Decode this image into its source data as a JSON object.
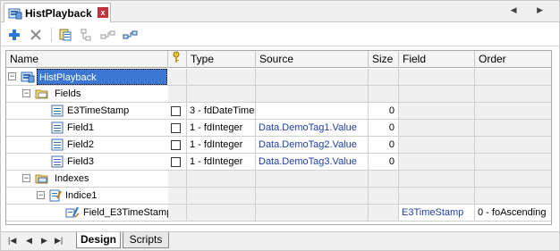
{
  "window": {
    "title": "HistPlayback",
    "close_label": "x"
  },
  "toolbar": {
    "icons": [
      "add-icon",
      "delete-icon",
      "properties-icon",
      "link-icon",
      "connect-icon",
      "connect-field-icon"
    ]
  },
  "columns": {
    "name": "Name",
    "key_icon": "key-icon",
    "type": "Type",
    "source": "Source",
    "size": "Size",
    "field": "Field",
    "order": "Order"
  },
  "rows": [
    {
      "name": "HistPlayback",
      "type": "",
      "source": "",
      "size": "",
      "field": "",
      "order": "",
      "checkbox": false
    },
    {
      "name": "Fields",
      "type": "",
      "source": "",
      "size": "",
      "field": "",
      "order": "",
      "checkbox": false
    },
    {
      "name": "E3TimeStamp",
      "type": "3 - fdDateTime",
      "source": "",
      "size": "0",
      "field": "",
      "order": "",
      "checkbox": true
    },
    {
      "name": "Field1",
      "type": "1 - fdInteger",
      "source": "Data.DemoTag1.Value",
      "size": "0",
      "field": "",
      "order": "",
      "checkbox": true
    },
    {
      "name": "Field2",
      "type": "1 - fdInteger",
      "source": "Data.DemoTag2.Value",
      "size": "0",
      "field": "",
      "order": "",
      "checkbox": true
    },
    {
      "name": "Field3",
      "type": "1 - fdInteger",
      "source": "Data.DemoTag3.Value",
      "size": "0",
      "field": "",
      "order": "",
      "checkbox": true
    },
    {
      "name": "Indexes",
      "type": "",
      "source": "",
      "size": "",
      "field": "",
      "order": "",
      "checkbox": false
    },
    {
      "name": "Indice1",
      "type": "",
      "source": "",
      "size": "",
      "field": "",
      "order": "",
      "checkbox": false
    },
    {
      "name": "Field_E3TimeStamp",
      "type": "",
      "source": "",
      "size": "",
      "field": "E3TimeStamp",
      "order": "0 - foAscending",
      "checkbox": false
    }
  ],
  "sheet_tabs": {
    "design": "Design",
    "scripts": "Scripts"
  },
  "colors": {
    "accent": "#3a78d4",
    "link": "#1f3ea8",
    "close": "#c4313a"
  }
}
